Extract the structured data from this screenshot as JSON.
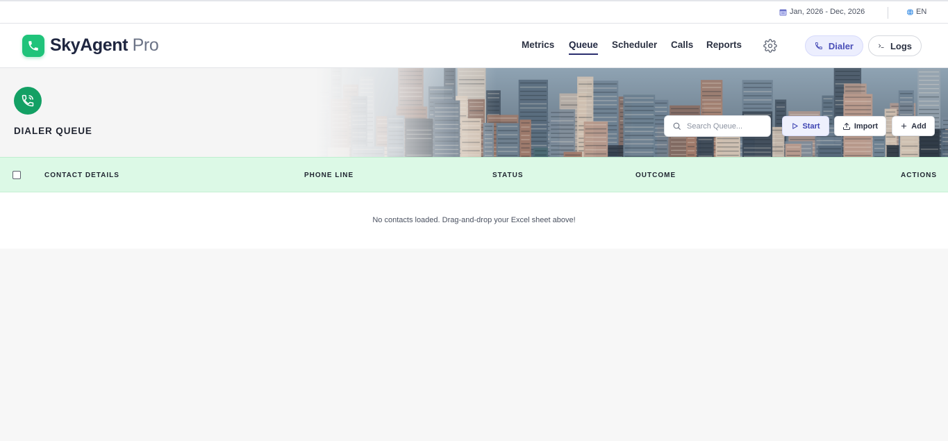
{
  "topbar": {
    "date_range": "Jan, 2026 - Dec, 2026",
    "date_icon": "calendar-icon",
    "language": "EN",
    "language_icon": "globe-icon"
  },
  "header": {
    "brand_main": "SkyAgent",
    "brand_suffix": "Pro",
    "logo_icon": "phone-icon",
    "nav": [
      "Metrics",
      "Queue",
      "Scheduler",
      "Calls",
      "Reports"
    ],
    "active_nav": "Queue",
    "settings_icon": "gear-icon",
    "dialer_label": "Dialer",
    "logs_label": "Logs"
  },
  "hero": {
    "title": "DIALER QUEUE",
    "title_icon": "phone-call-icon",
    "search_placeholder": "Search Queue...",
    "start_label": "Start",
    "import_label": "Import",
    "add_label": "Add"
  },
  "table": {
    "columns": [
      "CONTACT DETAILS",
      "PHONE LINE",
      "STATUS",
      "OUTCOME",
      "ACTIONS"
    ],
    "empty_message": "No contacts loaded. Drag-and-drop your Excel sheet above!"
  },
  "colors": {
    "brand_green": "#1fc37a",
    "icon_green": "#13a064",
    "header_row_bg": "#dcf9e6",
    "accent_indigo": "#4a4fb8"
  }
}
